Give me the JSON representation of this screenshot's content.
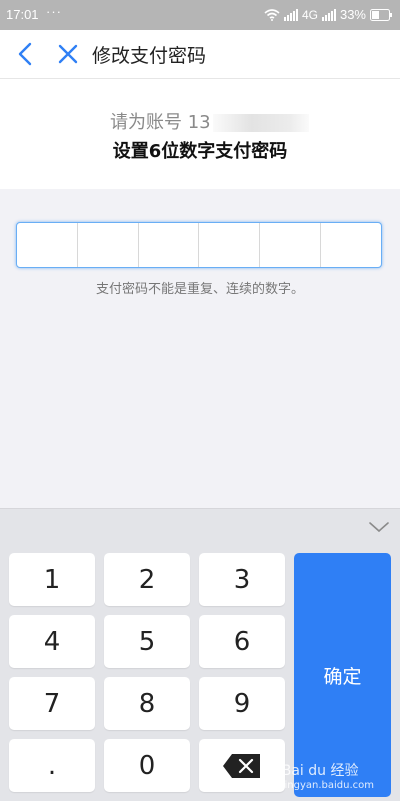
{
  "status": {
    "time": "17:01",
    "dots": "···",
    "network": "4G",
    "battery": "33%"
  },
  "nav": {
    "title": "修改支付密码"
  },
  "header": {
    "account_prefix": "请为账号 13",
    "instruction": "设置6位数字支付密码"
  },
  "pin": {
    "hint": "支付密码不能是重复、连续的数字。"
  },
  "keypad": {
    "keys": [
      "1",
      "2",
      "3",
      "4",
      "5",
      "6",
      "7",
      "8",
      "9",
      ".",
      "0"
    ],
    "confirm": "确定"
  },
  "watermark": {
    "brand": "Bai du 经验",
    "sub": "jingyan.baidu.com"
  },
  "colors": {
    "accent": "#2f7ff5",
    "nav_icon": "#2f7ff5"
  }
}
